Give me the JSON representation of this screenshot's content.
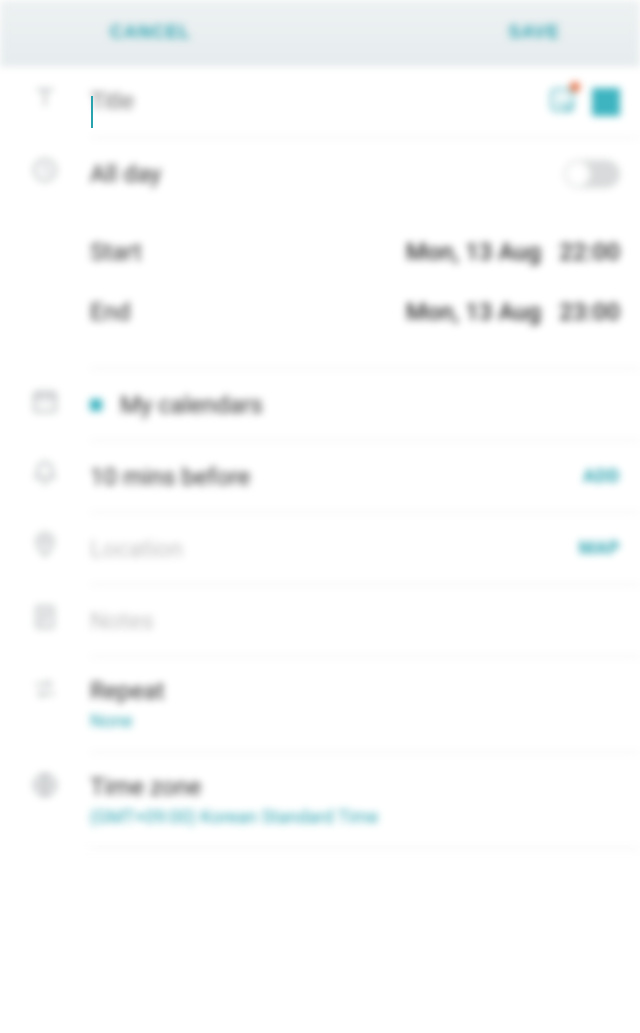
{
  "header": {
    "cancel": "CANCEL",
    "save": "SAVE"
  },
  "event": {
    "title_placeholder": "Title",
    "all_day_label": "All day",
    "start_label": "Start",
    "end_label": "End",
    "start_date": "Mon, 13 Aug",
    "start_time": "22:00",
    "end_date": "Mon, 13 Aug",
    "end_time": "23:00"
  },
  "calendar": {
    "name": "My calendars",
    "color": "#3db4c0"
  },
  "reminder": {
    "label": "10 mins before",
    "action": "ADD"
  },
  "location": {
    "placeholder": "Location",
    "action": "MAP"
  },
  "notes": {
    "placeholder": "Notes"
  },
  "repeat": {
    "label": "Repeat",
    "value": "None"
  },
  "timezone": {
    "label": "Time zone",
    "value": "(GMT+09:00) Korean Standard Time"
  }
}
